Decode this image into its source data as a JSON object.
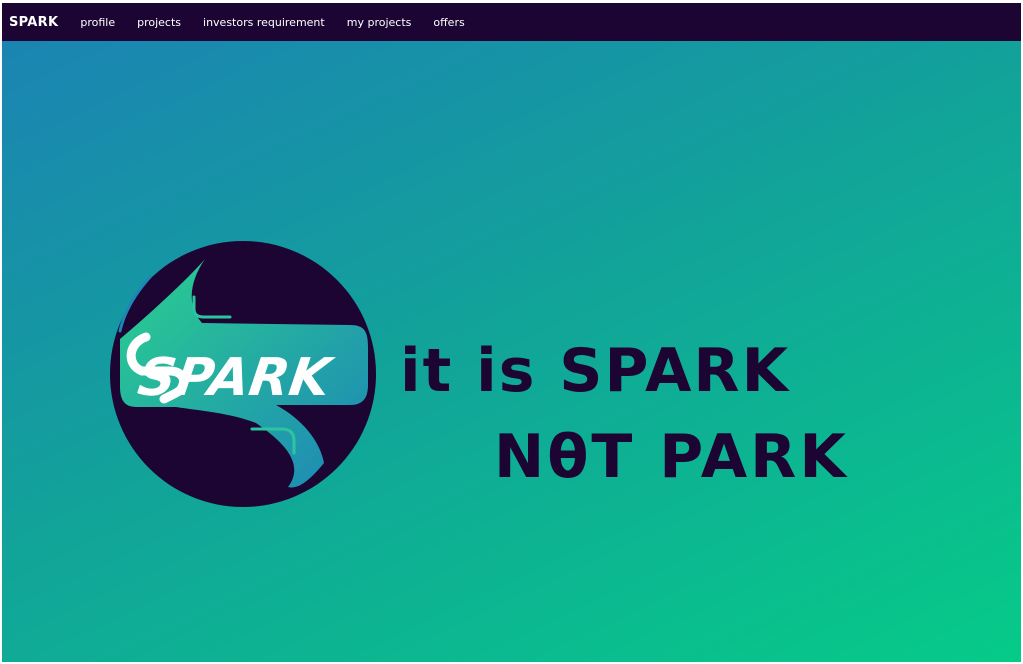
{
  "navbar": {
    "brand": "SPARK",
    "links": [
      "profile",
      "projects",
      "investors requirement",
      "my projects",
      "offers"
    ]
  },
  "hero": {
    "logo_text": "SPARK",
    "tagline_line1": "it is SPARK",
    "tagline_line2": "NθT PARK"
  },
  "colors": {
    "navbar_bg": "#1c0533",
    "text_dark": "#1c0533",
    "gradient_start": "#1b84b3",
    "gradient_end": "#06cb88",
    "logo_green": "#2bd08f",
    "logo_blue": "#1d86b7"
  }
}
